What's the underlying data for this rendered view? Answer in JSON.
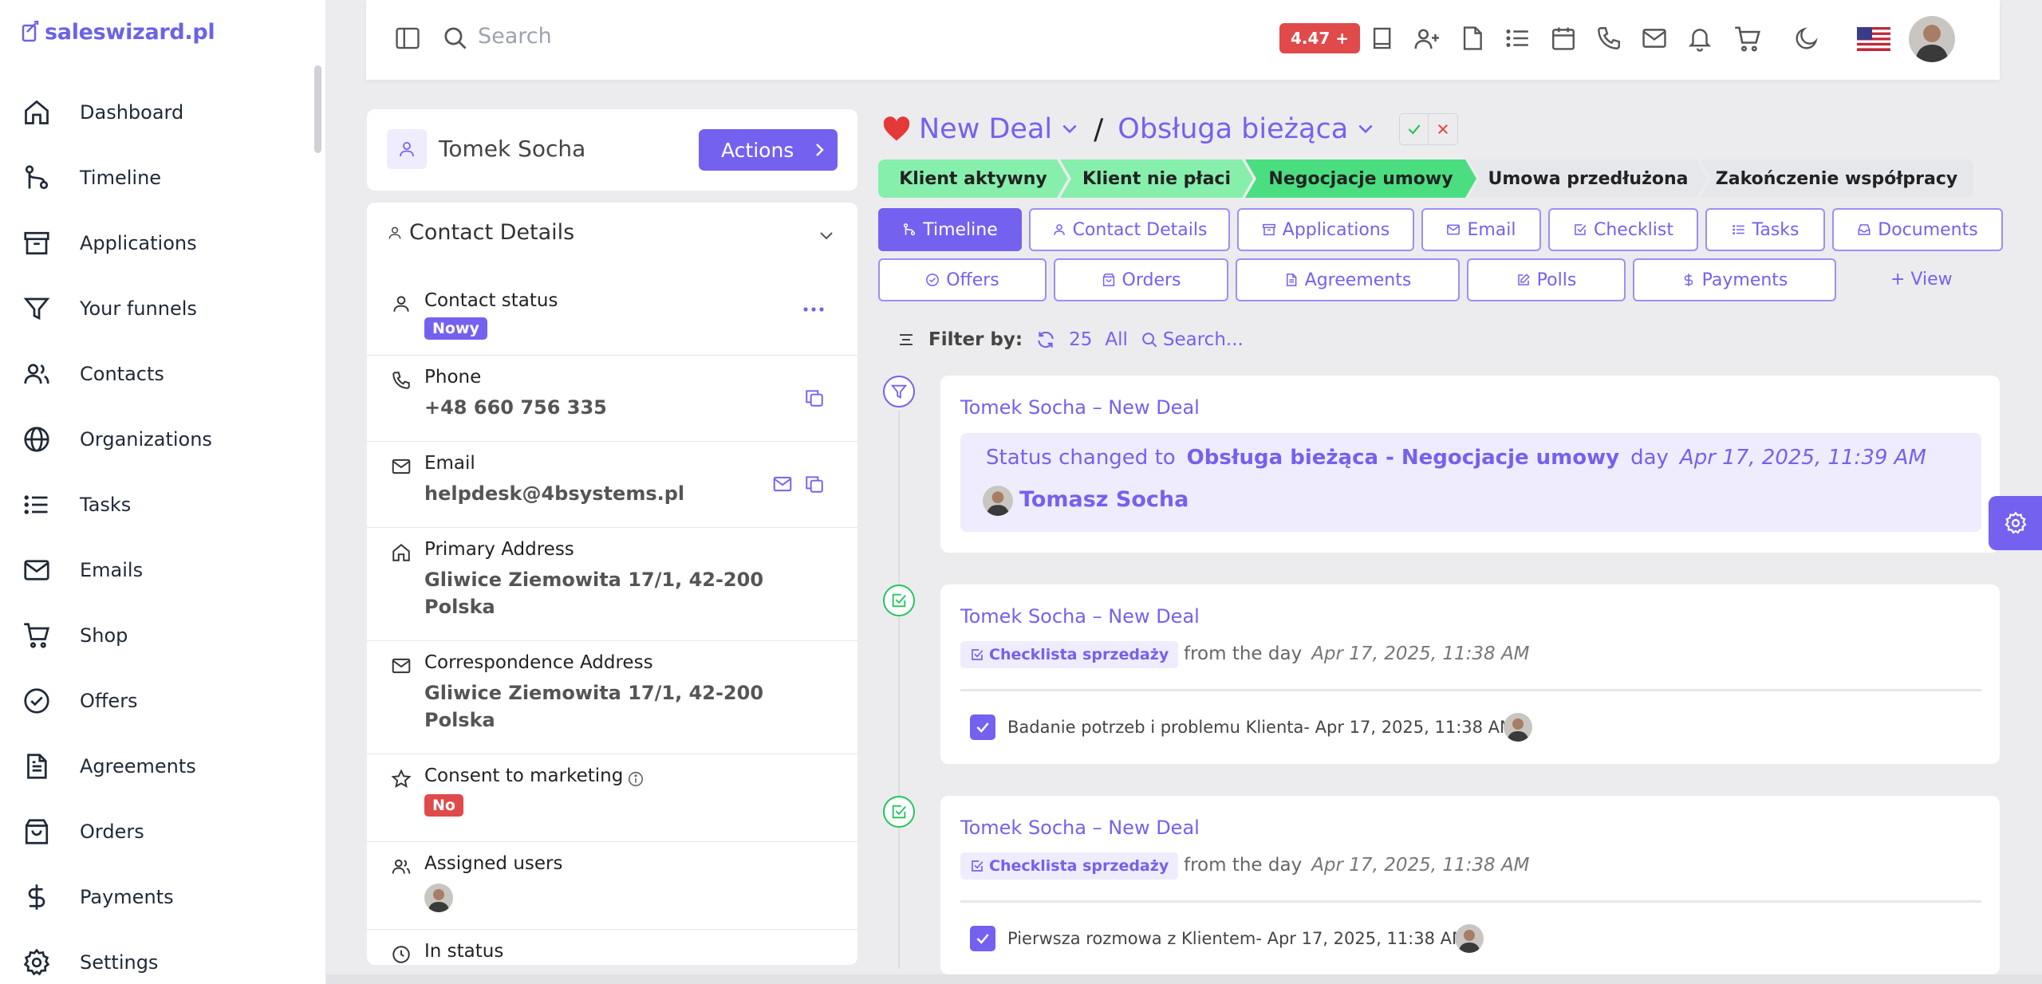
{
  "brand": {
    "name": "saleswizard.pl"
  },
  "sidebar": {
    "items": [
      {
        "label": "Dashboard",
        "icon": "home-icon"
      },
      {
        "label": "Timeline",
        "icon": "git-branch-icon"
      },
      {
        "label": "Applications",
        "icon": "archive-icon"
      },
      {
        "label": "Your funnels",
        "icon": "funnel-icon"
      },
      {
        "label": "Contacts",
        "icon": "users-icon"
      },
      {
        "label": "Organizations",
        "icon": "globe-icon"
      },
      {
        "label": "Tasks",
        "icon": "list-icon"
      },
      {
        "label": "Emails",
        "icon": "mail-icon"
      },
      {
        "label": "Shop",
        "icon": "cart-icon"
      },
      {
        "label": "Offers",
        "icon": "check-circle-icon"
      },
      {
        "label": "Agreements",
        "icon": "file-text-icon"
      },
      {
        "label": "Orders",
        "icon": "shopping-bag-icon"
      },
      {
        "label": "Payments",
        "icon": "dollar-icon"
      },
      {
        "label": "Settings",
        "icon": "gear-icon"
      }
    ]
  },
  "topbar": {
    "search_placeholder": "Search",
    "version": "4.47 +",
    "language": "en-US"
  },
  "contact": {
    "name": "Tomek Socha",
    "actions_label": "Actions"
  },
  "details": {
    "title": "Contact Details",
    "status_label": "Contact status",
    "status_value": "Nowy",
    "phone_label": "Phone",
    "phone_value": "+48 660 756 335",
    "email_label": "Email",
    "email_value": "helpdesk@4bsystems.pl",
    "primary_label": "Primary Address",
    "primary_line1": "Gliwice Ziemowita 17/1, 42-200",
    "primary_line2": "Polska",
    "corr_label": "Correspondence Address",
    "corr_line1": "Gliwice Ziemowita 17/1, 42-200",
    "corr_line2": "Polska",
    "consent_label": "Consent to marketing",
    "consent_value": "No",
    "assigned_label": "Assigned users",
    "instatus_label": "In status"
  },
  "deal": {
    "name": "New Deal",
    "slash": "/",
    "pipeline": "Obsługa bieżąca",
    "stages": [
      "Klient aktywny",
      "Klient nie płaci",
      "Negocjacje umowy",
      "Umowa przedłużona",
      "Zakończenie współpracy"
    ],
    "stage_colors": [
      "#86efac",
      "#86efac",
      "#4ade80",
      "#e5e7eb",
      "#e5e7eb"
    ]
  },
  "tabs_row1": [
    "Timeline",
    "Contact Details",
    "Applications",
    "Email",
    "Checklist",
    "Tasks",
    "Documents"
  ],
  "tabs_row2": [
    "Offers",
    "Orders",
    "Agreements",
    "Polls",
    "Payments"
  ],
  "view_label": "+ View",
  "filter": {
    "label": "Filter by:",
    "count": "25",
    "all": "All",
    "search": "Search..."
  },
  "timeline": [
    {
      "title": "Tomek Socha – New Deal",
      "status_prefix": "Status changed to",
      "status_value": "Obsługa bieżąca - Negocjacje umowy",
      "day_label": "day",
      "date": "Apr 17, 2025, 11:39 AM",
      "user": "Tomasz Socha"
    },
    {
      "title": "Tomek Socha – New Deal",
      "chip": "Checklista sprzedaży",
      "from": "from the day",
      "date": "Apr 17, 2025, 11:38 AM",
      "item": "Badanie potrzeb i problemu Klienta- Apr 17, 2025, 11:38 AM"
    },
    {
      "title": "Tomek Socha – New Deal",
      "chip": "Checklista sprzedaży",
      "from": "from the day",
      "date": "Apr 17, 2025, 11:38 AM",
      "item": "Pierwsza rozmowa z Klientem- Apr 17, 2025, 11:38 AM"
    }
  ],
  "colors": {
    "accent": "#7461ef",
    "danger": "#e04a4a",
    "success": "#4ade80"
  }
}
